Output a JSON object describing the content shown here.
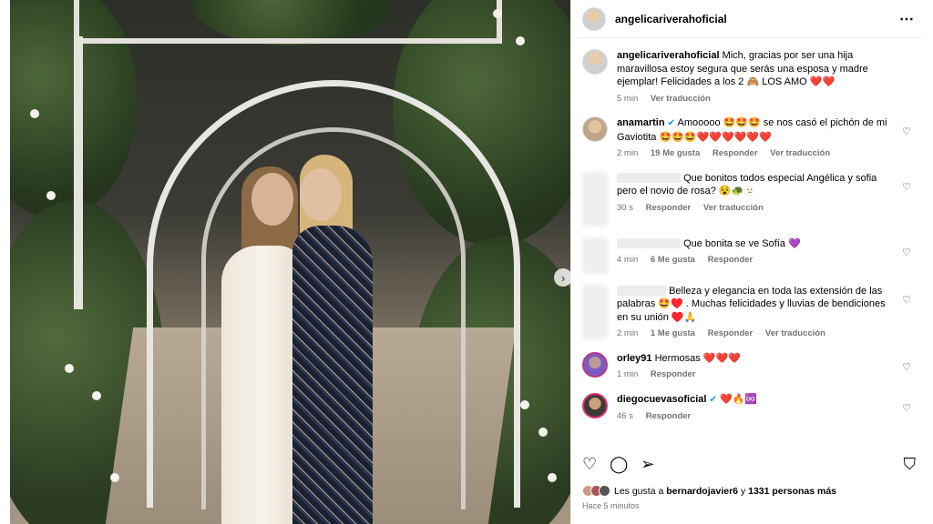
{
  "post": {
    "username": "angelicariverahoficial",
    "more_icon": "⋯",
    "next_arrow": "›"
  },
  "comments": [
    {
      "user": "angelicariverahoficial",
      "verified": false,
      "text": "Mich, gracias por ser una hija maravillosa estoy segura que serás una esposa y madre ejemplar! Felicidades a los 2 🙈 LOS AMO ❤️❤️",
      "time": "5 min",
      "likes": "",
      "reply": "",
      "translate": "Ver traducción"
    },
    {
      "user": "anamartin",
      "verified": true,
      "text": "Amooooo 🤩🤩🤩 se nos casó el pichón de mi Gaviotita 🤩🤩🤩❤️❤️❤️❤️❤️❤️",
      "time": "2 min",
      "likes": "19 Me gusta",
      "reply": "Responder",
      "translate": "Ver traducción"
    },
    {
      "user": "",
      "verified": false,
      "text": "Que bonitos todos especial Angélica y sofia pero el novio de rosa? 😵🐢🫥",
      "time": "30 s",
      "likes": "",
      "reply": "Responder",
      "translate": "Ver traducción"
    },
    {
      "user": "",
      "verified": false,
      "text": "Que bonita se ve Sofía 💜",
      "time": "4 min",
      "likes": "6 Me gusta",
      "reply": "Responder",
      "translate": ""
    },
    {
      "user": "",
      "verified": false,
      "text": "Belleza y elegancia en toda las extensión de las palabras 🤩♥️ . Muchas felicidades y lluvias de bendiciones en su unión ♥️🙏",
      "time": "2 min",
      "likes": "1 Me gusta",
      "reply": "Responder",
      "translate": "Ver traducción"
    },
    {
      "user": "orley91",
      "verified": false,
      "text": "Hermosas ❤️❤️❤️",
      "time": "1 min",
      "likes": "",
      "reply": "Responder",
      "translate": ""
    },
    {
      "user": "diegocuevasoficial",
      "verified": true,
      "text": "❤️🔥♾️",
      "time": "46 s",
      "likes": "",
      "reply": "Responder",
      "translate": ""
    }
  ],
  "actions": {
    "like_icon": "♡",
    "comment_icon": "◯",
    "share_icon": "➢",
    "save_icon": "⛉"
  },
  "likes": {
    "prefix": "Les gusta a ",
    "user": "bernardojavier6",
    "middle": " y ",
    "count": "1331 personas más"
  },
  "posted": "Hace 5 minutos",
  "heart_icon": "♡"
}
